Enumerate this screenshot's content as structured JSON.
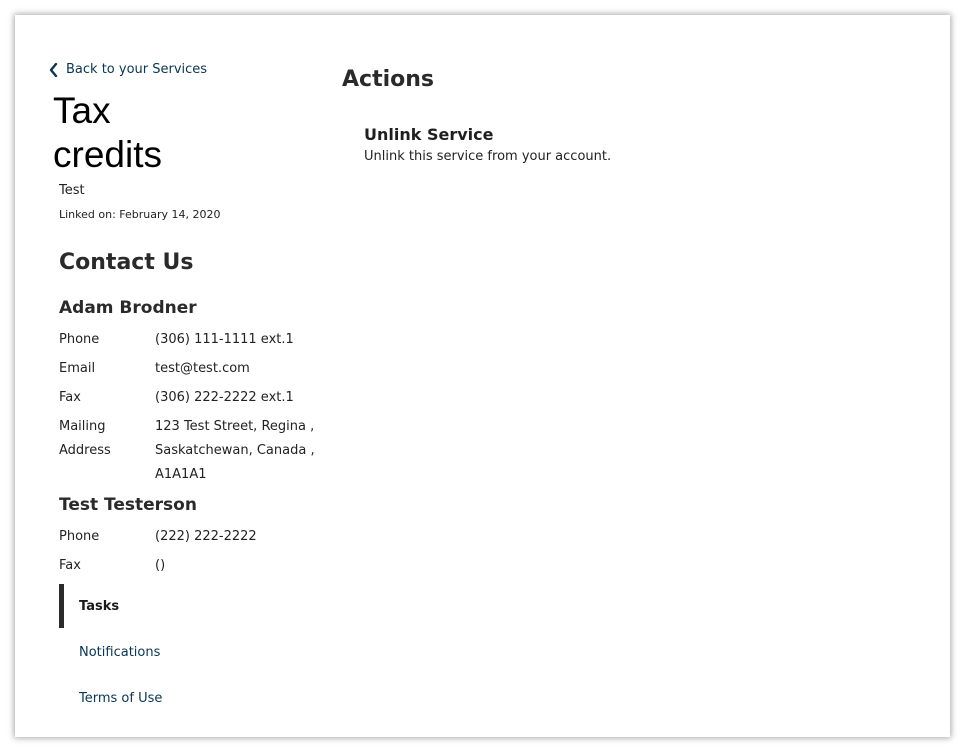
{
  "back_link": "Back to your Services",
  "service": {
    "title": "Tax credits",
    "name": "Test",
    "linked_on": "Linked on: February 14, 2020"
  },
  "contact": {
    "heading": "Contact Us",
    "people": [
      {
        "name": "Adam Brodner",
        "phone_label": "Phone",
        "phone": "(306) 111-1111 ext.1",
        "email_label": "Email",
        "email": "test@test.com",
        "fax_label": "Fax",
        "fax": "(306) 222-2222 ext.1",
        "mailing_label_1": "Mailing",
        "mailing_label_2": "Address",
        "address_line1": "123 Test Street, Regina ,",
        "address_line2": "Saskatchewan, Canada ,",
        "address_line3": "A1A1A1"
      },
      {
        "name": "Test Testerson",
        "phone_label": "Phone",
        "phone": "(222) 222-2222",
        "fax_label": "Fax",
        "fax": "()"
      }
    ]
  },
  "nav": {
    "items": [
      {
        "label": "Tasks"
      },
      {
        "label": "Notifications"
      },
      {
        "label": "Terms of Use"
      }
    ]
  },
  "actions": {
    "heading": "Actions",
    "unlink_title": "Unlink Service",
    "unlink_desc": "Unlink this service from your account."
  },
  "icons": {
    "back": "chevron-left-icon"
  },
  "colors": {
    "link": "#0b3550",
    "active_bar": "#2b2b2b"
  }
}
